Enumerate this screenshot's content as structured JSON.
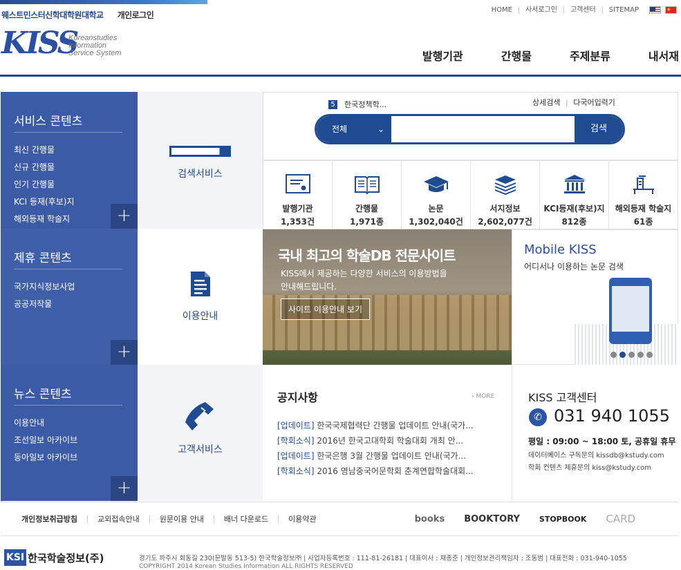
{
  "header": {
    "institution": "웨스트민스터신학대학원대학교",
    "personal_login": "개인로그인",
    "util": [
      "HOME",
      "사서로그인",
      "고객센터",
      "SITEMAP"
    ],
    "logo": {
      "text": "KISS",
      "sub1": "Koreanstudies",
      "sub2": "Information",
      "sub3": "Service System"
    },
    "gnb": [
      "발행기관",
      "간행물",
      "주제분류",
      "내서재"
    ]
  },
  "left": [
    {
      "title": "서비스 콘텐츠",
      "items": [
        "최신 간행물",
        "신규 간행물",
        "인기 간행물",
        "KCI 등재(후보)지",
        "해외등재 학술지"
      ]
    },
    {
      "title": "제휴 콘텐츠",
      "items": [
        "국가지식정보사업",
        "공공저작물"
      ]
    },
    {
      "title": "뉴스 콘텐츠",
      "items": [
        "이용안내",
        "조선일보 아카이브",
        "동아일보 아카이브"
      ]
    }
  ],
  "services": [
    "검색서비스",
    "이용안내",
    "고객서비스"
  ],
  "search": {
    "rank": "5",
    "popular": "한국정책학...",
    "advanced": "상세검색",
    "multilang": "다국어입력기",
    "scope": "전체",
    "button": "검색",
    "value": ""
  },
  "stats": [
    {
      "label": "발행기관",
      "value": "1,353건"
    },
    {
      "label": "간행물",
      "value": "1,971종"
    },
    {
      "label": "논문",
      "value": "1,302,040건"
    },
    {
      "label": "서지정보",
      "value": "2,602,077건"
    },
    {
      "label": "KCI등재(후보)지",
      "value": "812종"
    },
    {
      "label": "해외등재 학술지",
      "value": "61종"
    }
  ],
  "banner": {
    "title": "국내 최고의 학술DB 전문사이트",
    "line1": "KISS에서 제공하는 다양한 서비스의 이용방법을",
    "line2": "안내해드립니다.",
    "button": "사이트 이용안내 보기"
  },
  "mobile": {
    "title": "Mobile KISS",
    "sub": "어디서나 이용하는 논문 검색"
  },
  "notice": {
    "title": "공지사항",
    "more": "› MORE",
    "items": [
      {
        "tag": "[업데이트]",
        "text": "한국국제협력단 간행물 업데이트 안내(국가..."
      },
      {
        "tag": "[학회소식]",
        "text": "2016년 한국고대학회 학술대회 개최 안..."
      },
      {
        "tag": "[업데이트]",
        "text": "한국은행 3월 간행물 업데이트 안내(국가..."
      },
      {
        "tag": "[학회소식]",
        "text": "2016 영남중국어문학회 춘계연합학술대회..."
      }
    ]
  },
  "cs": {
    "title": "KISS 고객센터",
    "phone": "031 940 1055",
    "hours": "평일 : 09:00 ~ 18:00 토, 공휴일 휴무",
    "mail1": "데이터베이스 구독문의 kissdb@kstudy.com",
    "mail2": "학회 컨텐츠 제휴문의 kiss@kstudy.com"
  },
  "footer": {
    "links": [
      "개인정보취급방침",
      "교외접속안내",
      "원문이용 안내",
      "배너 다운로드",
      "이용약관"
    ],
    "partners": [
      "books",
      "BOOKTORY",
      "STOPBOOK",
      "CARD"
    ],
    "company": "한국학술정보(주)",
    "address": "경기도 파주시 회동길 230(문발동 513-5) 한국학술정보㈜  |  사업자등록번호 : 111-81-26181 | 대표이사 : 채종준  |  개인정보관리책임자 : 조동범  |  대표전화 : 031-940-1055",
    "copyright": "COPYRIGHT 2014 Korean Studies Information ALL RIGHTS RESERVED"
  },
  "colors": {
    "primary": "#1f4b91",
    "left_panel": "#3b5ba6",
    "accent_tag": "#1f4b91"
  }
}
